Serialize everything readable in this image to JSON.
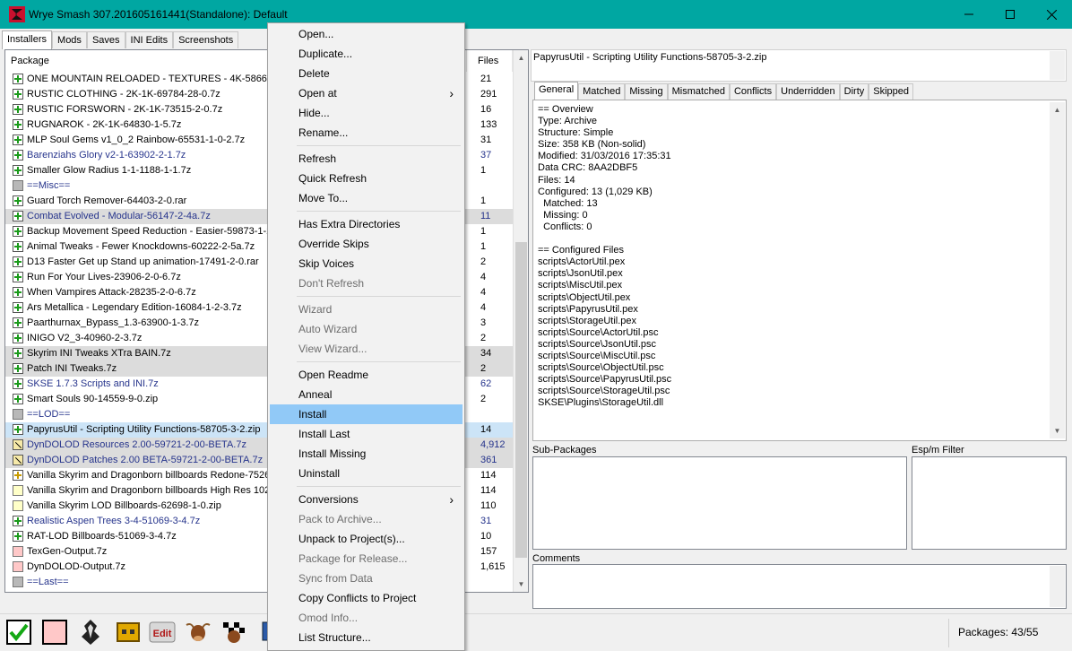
{
  "window": {
    "title": "Wrye Smash 307.201605161441(Standalone): Default"
  },
  "main_tabs": [
    "Installers",
    "Mods",
    "Saves",
    "INI Edits",
    "Screenshots"
  ],
  "package_list": {
    "col_package": "Package",
    "col_files": "Files",
    "rows": [
      {
        "name": "ONE MOUNTAIN RELOADED - TEXTURES - 4K-58666-1-...",
        "files": "21",
        "icon": "plus",
        "style": "normal"
      },
      {
        "name": "RUSTIC CLOTHING - 2K-1K-69784-28-0.7z",
        "files": "291",
        "icon": "plus",
        "style": "normal"
      },
      {
        "name": "RUSTIC FORSWORN - 2K-1K-73515-2-0.7z",
        "files": "16",
        "icon": "plus",
        "style": "normal"
      },
      {
        "name": "RUGNAROK - 2K-1K-64830-1-5.7z",
        "files": "133",
        "icon": "plus",
        "style": "normal"
      },
      {
        "name": "MLP Soul Gems v1_0_2 Rainbow-65531-1-0-2.7z",
        "files": "31",
        "icon": "plus",
        "style": "normal"
      },
      {
        "name": "Barenziahs Glory v2-1-63902-2-1.7z",
        "files": "37",
        "icon": "plus",
        "style": "blue"
      },
      {
        "name": "Smaller Glow Radius 1-1-1188-1-1.7z",
        "files": "1",
        "icon": "plus",
        "style": "normal"
      },
      {
        "name": "==Misc==",
        "files": "",
        "icon": "gray",
        "style": "blue"
      },
      {
        "name": "Guard Torch Remover-64403-2-0.rar",
        "files": "1",
        "icon": "plus",
        "style": "normal"
      },
      {
        "name": "Combat Evolved - Modular-56147-2-4a.7z",
        "files": "11",
        "icon": "plus",
        "style": "blue-grey"
      },
      {
        "name": "Backup Movement Speed Reduction - Easier-59873-1-2...",
        "files": "1",
        "icon": "plus",
        "style": "normal"
      },
      {
        "name": "Animal Tweaks - Fewer Knockdowns-60222-2-5a.7z",
        "files": "1",
        "icon": "plus",
        "style": "normal"
      },
      {
        "name": "D13 Faster Get up Stand up animation-17491-2-0.rar",
        "files": "2",
        "icon": "plus",
        "style": "normal"
      },
      {
        "name": "Run For Your Lives-23906-2-0-6.7z",
        "files": "4",
        "icon": "plus",
        "style": "normal"
      },
      {
        "name": "When Vampires Attack-28235-2-0-6.7z",
        "files": "4",
        "icon": "plus",
        "style": "normal"
      },
      {
        "name": "Ars Metallica - Legendary Edition-16084-1-2-3.7z",
        "files": "4",
        "icon": "plus",
        "style": "normal"
      },
      {
        "name": "Paarthurnax_Bypass_1.3-63900-1-3.7z",
        "files": "3",
        "icon": "plus",
        "style": "normal"
      },
      {
        "name": "INIGO V2_3-40960-2-3.7z",
        "files": "2",
        "icon": "plus",
        "style": "normal"
      },
      {
        "name": "Skyrim INI Tweaks XTra BAIN.7z",
        "files": "34",
        "icon": "plus",
        "style": "grey"
      },
      {
        "name": "Patch INI Tweaks.7z",
        "files": "2",
        "icon": "plus",
        "style": "grey"
      },
      {
        "name": "SKSE 1.7.3 Scripts and INI.7z",
        "files": "62",
        "icon": "plus",
        "style": "blue"
      },
      {
        "name": "Smart Souls 90-14559-9-0.zip",
        "files": "2",
        "icon": "plus",
        "style": "normal"
      },
      {
        "name": "==LOD==",
        "files": "",
        "icon": "gray",
        "style": "blue"
      },
      {
        "name": "PapyrusUtil - Scripting Utility Functions-58705-3-2.zip",
        "files": "14",
        "icon": "plus",
        "style": "selected"
      },
      {
        "name": "DynDOLOD Resources 2.00-59721-2-00-BETA.7z",
        "files": "4,912",
        "icon": "partial",
        "style": "blue-grey"
      },
      {
        "name": "DynDOLOD Patches 2.00 BETA-59721-2-00-BETA.7z",
        "files": "361",
        "icon": "partial",
        "style": "blue-grey"
      },
      {
        "name": "Vanilla Skyrim and Dragonborn billboards Redone-75269...",
        "files": "114",
        "icon": "yplus",
        "style": "normal"
      },
      {
        "name": "Vanilla Skyrim and Dragonborn billboards High Res 1024...",
        "files": "114",
        "icon": "yellow",
        "style": "normal"
      },
      {
        "name": "Vanilla Skyrim LOD Billboards-62698-1-0.zip",
        "files": "110",
        "icon": "yellow",
        "style": "normal"
      },
      {
        "name": "Realistic Aspen Trees 3-4-51069-3-4.7z",
        "files": "31",
        "icon": "plus",
        "style": "blue"
      },
      {
        "name": "RAT-LOD Billboards-51069-3-4.7z",
        "files": "10",
        "icon": "plus",
        "style": "normal"
      },
      {
        "name": "TexGen-Output.7z",
        "files": "157",
        "icon": "pink",
        "style": "normal"
      },
      {
        "name": "DynDOLOD-Output.7z",
        "files": "1,615",
        "icon": "pink",
        "style": "normal"
      },
      {
        "name": "==Last==",
        "files": "",
        "icon": "gray",
        "style": "blue"
      }
    ]
  },
  "details": {
    "package_title": "PapyrusUtil - Scripting Utility Functions-58705-3-2.zip",
    "tabs": [
      "General",
      "Matched",
      "Missing",
      "Mismatched",
      "Conflicts",
      "Underridden",
      "Dirty",
      "Skipped"
    ],
    "info_lines": [
      "== Overview",
      "Type: Archive",
      "Structure: Simple",
      "Size: 358 KB (Non-solid)",
      "Modified: 31/03/2016 17:35:31",
      "Data CRC: 8AA2DBF5",
      "Files: 14",
      "Configured: 13 (1,029 KB)",
      "  Matched: 13",
      "  Missing: 0",
      "  Conflicts: 0",
      "",
      "== Configured Files",
      "scripts\\ActorUtil.pex",
      "scripts\\JsonUtil.pex",
      "scripts\\MiscUtil.pex",
      "scripts\\ObjectUtil.pex",
      "scripts\\PapyrusUtil.pex",
      "scripts\\StorageUtil.pex",
      "scripts\\Source\\ActorUtil.psc",
      "scripts\\Source\\JsonUtil.psc",
      "scripts\\Source\\MiscUtil.psc",
      "scripts\\Source\\ObjectUtil.psc",
      "scripts\\Source\\PapyrusUtil.psc",
      "scripts\\Source\\StorageUtil.psc",
      "SKSE\\Plugins\\StorageUtil.dll"
    ],
    "sub_packages_label": "Sub-Packages",
    "esp_filter_label": "Esp/m Filter",
    "comments_label": "Comments"
  },
  "status": {
    "packages": "Packages: 43/55"
  },
  "toolbar": {
    "edit_label": "Edit",
    "icons": [
      "check-icon",
      "pink-square-icon",
      "skyrim-icon",
      "boss-icon",
      "edit-icon",
      "cow-icon",
      "checker-cow-icon",
      "monitor-icon"
    ]
  },
  "context_menu": {
    "items": [
      {
        "label": "Open...",
        "disabled": false
      },
      {
        "label": "Duplicate...",
        "disabled": false
      },
      {
        "label": "Delete",
        "disabled": false
      },
      {
        "label": "Open at",
        "disabled": false,
        "submenu": true
      },
      {
        "label": "Hide...",
        "disabled": false
      },
      {
        "label": "Rename...",
        "disabled": false,
        "sep_after": true
      },
      {
        "label": "Refresh",
        "disabled": false
      },
      {
        "label": "Quick Refresh",
        "disabled": false
      },
      {
        "label": "Move To...",
        "disabled": false,
        "sep_after": true
      },
      {
        "label": "Has Extra Directories",
        "disabled": false
      },
      {
        "label": "Override Skips",
        "disabled": false
      },
      {
        "label": "Skip Voices",
        "disabled": false
      },
      {
        "label": "Don't Refresh",
        "disabled": true,
        "sep_after": true
      },
      {
        "label": "Wizard",
        "disabled": true
      },
      {
        "label": "Auto Wizard",
        "disabled": true
      },
      {
        "label": "View Wizard...",
        "disabled": true,
        "sep_after": true
      },
      {
        "label": "Open Readme",
        "disabled": false
      },
      {
        "label": "Anneal",
        "disabled": false
      },
      {
        "label": "Install",
        "disabled": false,
        "highlighted": true
      },
      {
        "label": "Install Last",
        "disabled": false
      },
      {
        "label": "Install Missing",
        "disabled": false
      },
      {
        "label": "Uninstall",
        "disabled": false,
        "sep_after": true
      },
      {
        "label": "Conversions",
        "disabled": false,
        "submenu": true
      },
      {
        "label": "Pack to Archive...",
        "disabled": true
      },
      {
        "label": "Unpack to Project(s)...",
        "disabled": false
      },
      {
        "label": "Package for Release...",
        "disabled": true
      },
      {
        "label": "Sync from Data",
        "disabled": true
      },
      {
        "label": "Copy Conflicts to Project",
        "disabled": false
      },
      {
        "label": "Omod Info...",
        "disabled": true
      },
      {
        "label": "List Structure...",
        "disabled": false
      }
    ]
  }
}
